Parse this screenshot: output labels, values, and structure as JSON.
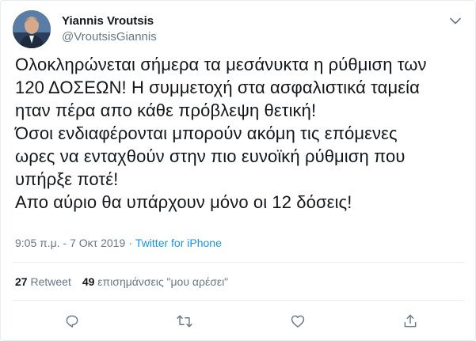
{
  "author": {
    "display_name": "Yiannis Vroutsis",
    "handle": "@VroutsisGiannis"
  },
  "tweet": {
    "text": "Ολοκληρώνεται σήμερα τα μεσάνυκτα η ρύθμιση των\n120 ΔΟΣΕΩΝ! Η συμμετοχή στα ασφαλιστικά ταμεία\nηταν πέρα απο κάθε πρόβλεψη θετική!\nΌσοι ενδιαφέρονται μπορούν ακόμη τις επόμενες\nωρες να ενταχθούν στην πιο ευνοϊκή ρύθμιση που\nυπήρξε ποτέ!\nΑπο αύριο θα υπάρχουν μόνο οι 12 δόσεις!",
    "time": "9:05 π.μ.",
    "separator": "·",
    "date": "7 Οκτ 2019",
    "source": "Twitter for iPhone"
  },
  "stats": {
    "retweets_count": "27",
    "retweets_label": "Retweet",
    "likes_count": "49",
    "likes_label": "επισημάνσεις \"μου αρέσει\""
  },
  "icons": {
    "caret": "chevron-down-icon",
    "reply": "reply-icon",
    "retweet": "retweet-icon",
    "like": "heart-icon",
    "share": "share-icon"
  },
  "colors": {
    "text": "#14171a",
    "secondary": "#657786",
    "link": "#1b95e0",
    "divider": "#e6ecf0"
  }
}
